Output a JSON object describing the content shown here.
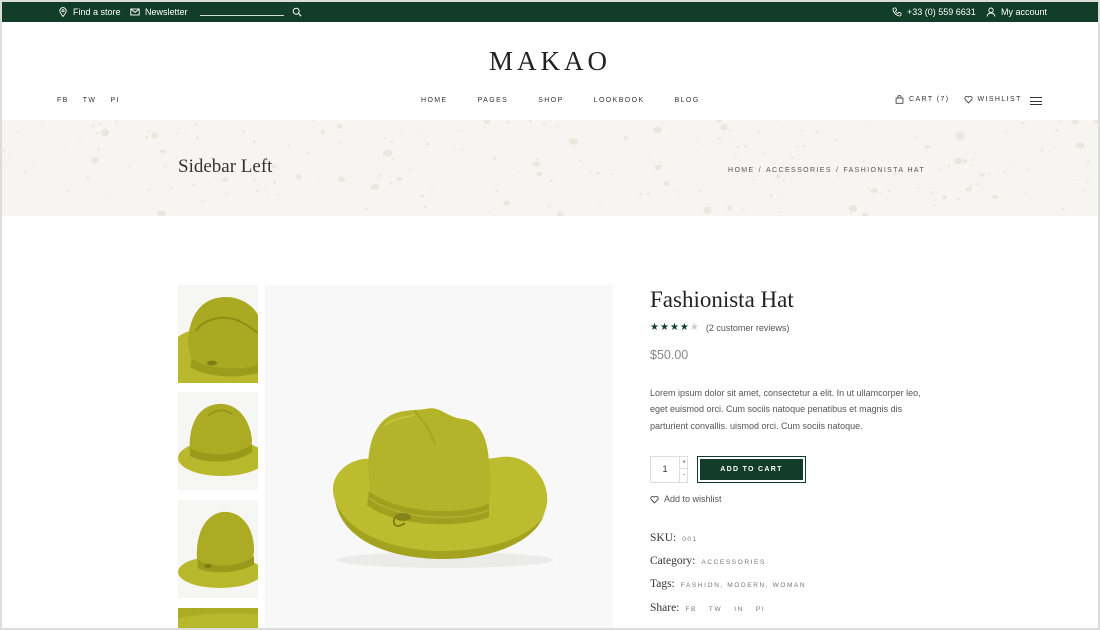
{
  "topbar": {
    "find_store": "Find a store",
    "newsletter": "Newsletter",
    "phone": "+33 (0) 559 6631",
    "account": "My account"
  },
  "header": {
    "logo": "MAKAO",
    "social": [
      "FB",
      "TW",
      "PI"
    ],
    "nav": [
      "HOME",
      "PAGES",
      "SHOP",
      "LOOKBOOK",
      "BLOG"
    ],
    "cart": "CART (7)",
    "wishlist": "WISHLIST"
  },
  "banner": {
    "title": "Sidebar Left",
    "breadcrumb": [
      "HOME",
      "/",
      "ACCESSORIES",
      "/",
      "FASHIONISTA HAT"
    ]
  },
  "product": {
    "title": "Fashionista Hat",
    "rating": 4,
    "rating_max": 5,
    "reviews": "(2 customer reviews)",
    "price": "$50.00",
    "description": "Lorem ipsum dolor sit amet, consectetur a elit. In ut ullamcorper leo, eget euismod orci. Cum sociis natoque penatibus et magnis dis parturient convallis. uismod orci. Cum sociis natoque.",
    "quantity": "1",
    "qty_plus": "+",
    "qty_minus": "-",
    "add_to_cart": "ADD TO CART",
    "add_to_wishlist": "Add to wishlist",
    "sku_label": "SKU:",
    "sku": "001",
    "category_label": "Category:",
    "category": "ACCESSORIES",
    "tags_label": "Tags:",
    "tags": "FASHION, MODERN, WOMAN",
    "share_label": "Share:",
    "share": [
      "FB",
      "TW",
      "IN",
      "PI"
    ]
  },
  "colors": {
    "brand_green": "#123d2b",
    "hat": "#b5b52b",
    "banner_bg": "#f7f5f1"
  },
  "icons": [
    "map-pin-icon",
    "mail-icon",
    "search-icon",
    "phone-icon",
    "user-icon",
    "bag-icon",
    "heart-icon",
    "hamburger-menu-icon",
    "star-icon"
  ]
}
